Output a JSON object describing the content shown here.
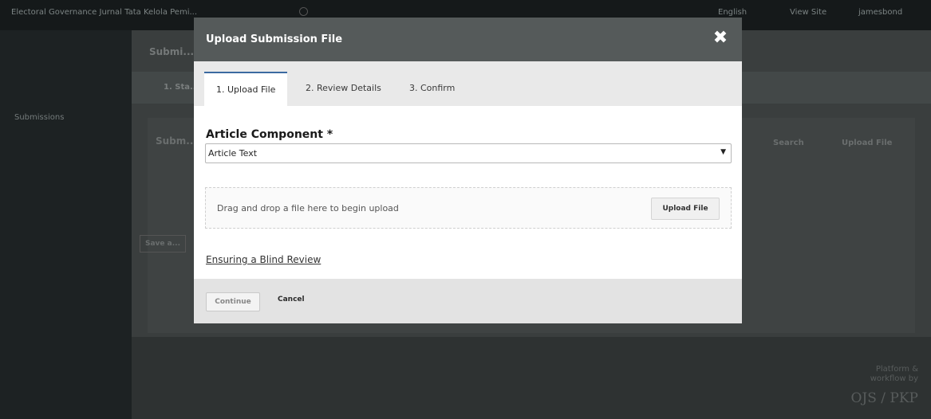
{
  "background": {
    "site_title": "Electoral Governance Jurnal Tata Kelola Pemi...",
    "language_link": "English",
    "view_site_link": "View Site",
    "user_menu": "jamesbond",
    "sidebar_submissions": "Submissions",
    "page_heading": "Submi...",
    "step_label": "1. Sta...",
    "panel_title": "Subm...",
    "panel_search": "Search",
    "panel_upload": "Upload File",
    "save_button": "Save a...",
    "footer_text": "Platform & workflow by",
    "footer_logo": "OJS / PKP"
  },
  "modal": {
    "title": "Upload Submission File",
    "close_symbol": "✖",
    "tabs": [
      {
        "label": "1. Upload File",
        "active": true
      },
      {
        "label": "2. Review Details",
        "active": false
      },
      {
        "label": "3. Confirm",
        "active": false
      }
    ],
    "article_component": {
      "label": "Article Component *",
      "selected": "Article Text",
      "arrow": "▼"
    },
    "dropzone": {
      "text": "Drag and drop a file here to begin upload",
      "button": "Upload File"
    },
    "blind_review_link": "Ensuring a Blind Review",
    "footer": {
      "continue": "Continue",
      "cancel": "Cancel"
    }
  },
  "colors": {
    "modal_header": "#555a5a",
    "active_tab_accent": "#3b6aa0",
    "overlay_dark": "#15191a"
  }
}
